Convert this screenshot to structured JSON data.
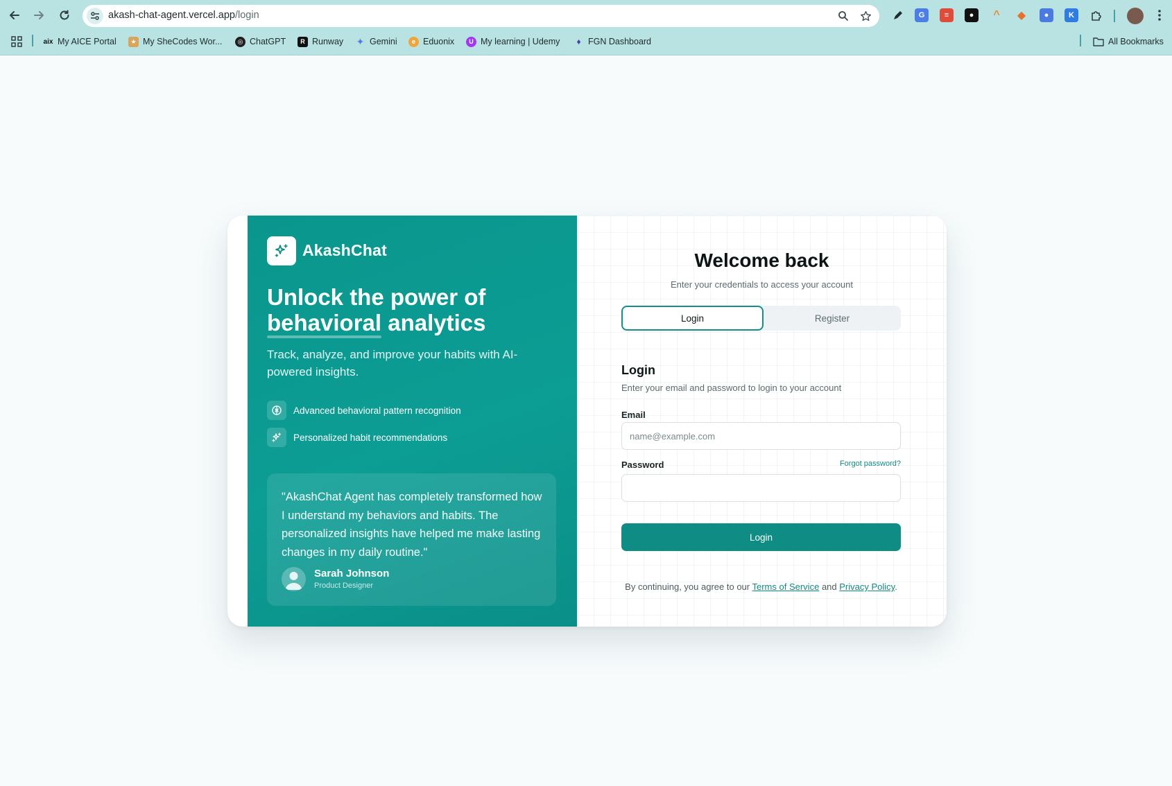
{
  "browser": {
    "url_host": "akash-chat-agent.vercel.app",
    "url_path": "/login",
    "bookmarks": [
      {
        "label": "My AICE Portal",
        "icon": "aice-icon"
      },
      {
        "label": "My SheCodes Wor...",
        "icon": "shecodes-icon"
      },
      {
        "label": "ChatGPT",
        "icon": "chatgpt-icon"
      },
      {
        "label": "Runway",
        "icon": "runway-icon"
      },
      {
        "label": "Gemini",
        "icon": "gemini-icon"
      },
      {
        "label": "Eduonix",
        "icon": "eduonix-icon"
      },
      {
        "label": "My learning | Udemy",
        "icon": "udemy-icon"
      },
      {
        "label": "FGN Dashboard",
        "icon": "fgn-icon"
      }
    ],
    "all_bookmarks": "All Bookmarks",
    "colors": {
      "chrome": "#b9e2e3",
      "accent": "#0f8c84"
    }
  },
  "promo": {
    "brand": "AkashChat",
    "headline_part1": "Unlock the power of",
    "headline_highlight": "behavioral",
    "headline_part2": "analytics",
    "subtitle": "Track, analyze, and improve your habits with AI-powered insights.",
    "features": [
      {
        "label": "Advanced behavioral pattern recognition",
        "icon": "brain-icon"
      },
      {
        "label": "Personalized habit recommendations",
        "icon": "sparkles-icon"
      }
    ],
    "testimonial": {
      "quote": "\"AkashChat Agent has completely transformed how I understand my behaviors and habits. The personalized insights have helped me make lasting changes in my daily routine.\"",
      "name": "Sarah Johnson",
      "role": "Product Designer"
    }
  },
  "auth": {
    "title": "Welcome back",
    "subtitle": "Enter your credentials to access your account",
    "tabs": {
      "login": "Login",
      "register": "Register"
    },
    "form_title": "Login",
    "form_subtitle": "Enter your email and password to login to your account",
    "email_label": "Email",
    "email_placeholder": "name@example.com",
    "email_value": "",
    "password_label": "Password",
    "password_value": "",
    "forgot": "Forgot password?",
    "submit": "Login",
    "legal_prefix": "By continuing, you agree to our",
    "terms": "Terms of Service",
    "legal_and": "and",
    "privacy": "Privacy Policy",
    "legal_suffix": "."
  }
}
